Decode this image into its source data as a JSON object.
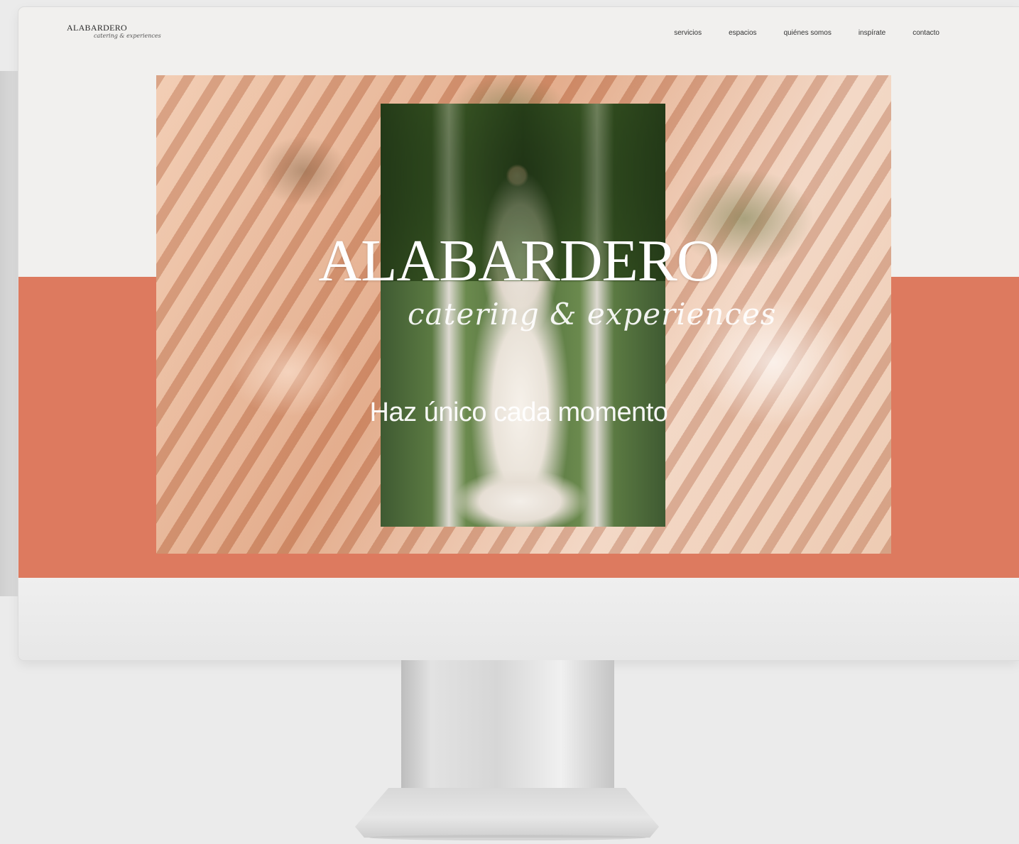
{
  "site": {
    "logo_main": "ALABARDERO",
    "logo_script": "catering & experiences"
  },
  "nav": {
    "items": [
      {
        "label": "servicios"
      },
      {
        "label": "espacios"
      },
      {
        "label": "quiénes somos"
      },
      {
        "label": "inspírate"
      },
      {
        "label": "contacto"
      }
    ]
  },
  "hero": {
    "title": "ALABARDERO",
    "subtitle": "catering & experiences",
    "tagline": "Haz único cada momento"
  },
  "colors": {
    "accent_coral": "#dd7a5f",
    "page_background": "#f1f0ee"
  }
}
